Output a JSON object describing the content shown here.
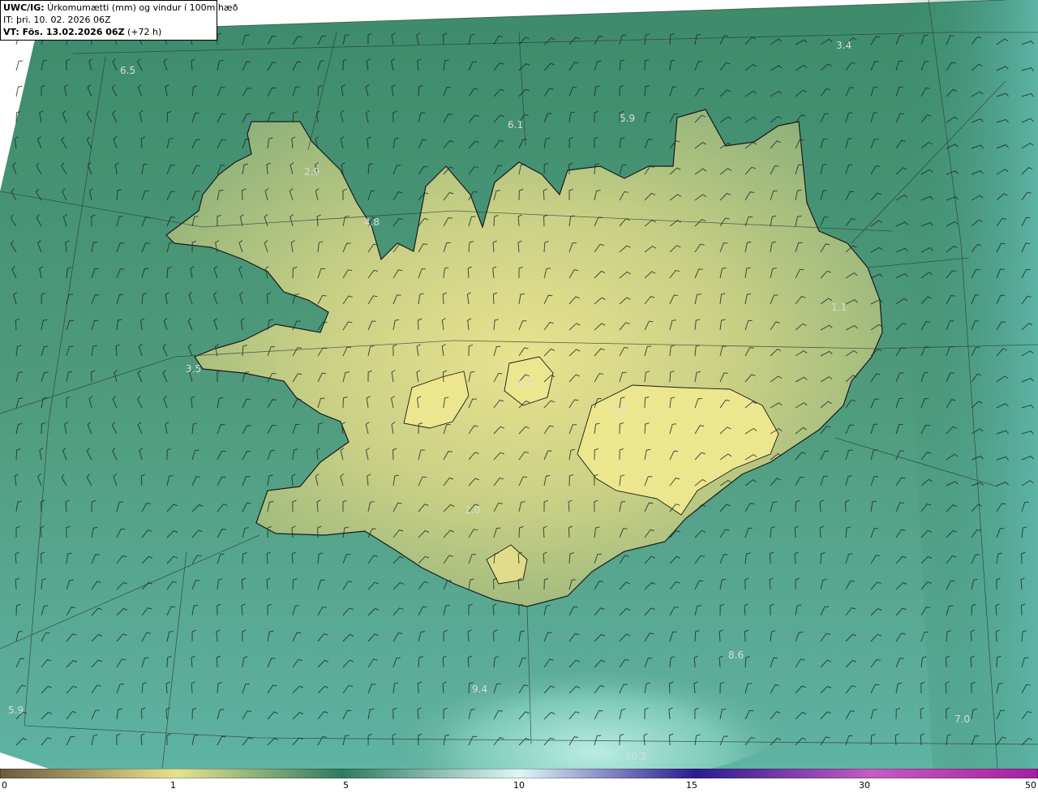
{
  "header": {
    "product": "UWC/IG:",
    "field": " Úrkomumætti (mm) og vindur í 100m hæð",
    "it_label": "IT:",
    "it_value": " þri. 10. 02. 2026 06Z",
    "vt_label": "VT:",
    "vt_value": " Fös. 13.02.2026 06Z",
    "vt_lead": " (+72 h)"
  },
  "colorbar": {
    "ticks": [
      "0",
      "1",
      "5",
      "10",
      "15",
      "30",
      "50"
    ],
    "colors": [
      "#6b5a3e",
      "#b9a468",
      "#e6e28f",
      "#2f7a62",
      "#6cc7b7",
      "#dff6f5",
      "#2b1b8f",
      "#7a1fa8",
      "#c55cc0",
      "#a51f9e"
    ]
  },
  "map_values": [
    {
      "name": "value-label-nw-sea",
      "text": "6.5"
    },
    {
      "name": "value-label-ne-sea",
      "text": "3.4"
    },
    {
      "name": "value-label-north-1",
      "text": "6.1"
    },
    {
      "name": "value-label-north-2",
      "text": "5.9"
    },
    {
      "name": "value-label-westfjords",
      "text": "2.9"
    },
    {
      "name": "value-label-west-coast",
      "text": "4.8"
    },
    {
      "name": "value-label-east",
      "text": "1.1"
    },
    {
      "name": "value-label-snaefellsnes",
      "text": "3.5"
    },
    {
      "name": "value-label-hofsjokull",
      "text": "1.2"
    },
    {
      "name": "value-label-vatnajokull",
      "text": "1.0"
    },
    {
      "name": "value-label-south",
      "text": "2.0"
    },
    {
      "name": "value-label-sw-corner",
      "text": "5.9"
    },
    {
      "name": "value-label-se-sea",
      "text": "7.0"
    },
    {
      "name": "value-label-south-sea",
      "text": "10.2"
    },
    {
      "name": "value-label-se-offshore",
      "text": "8.6"
    },
    {
      "name": "value-label-s-offshore",
      "text": "9.4"
    }
  ]
}
